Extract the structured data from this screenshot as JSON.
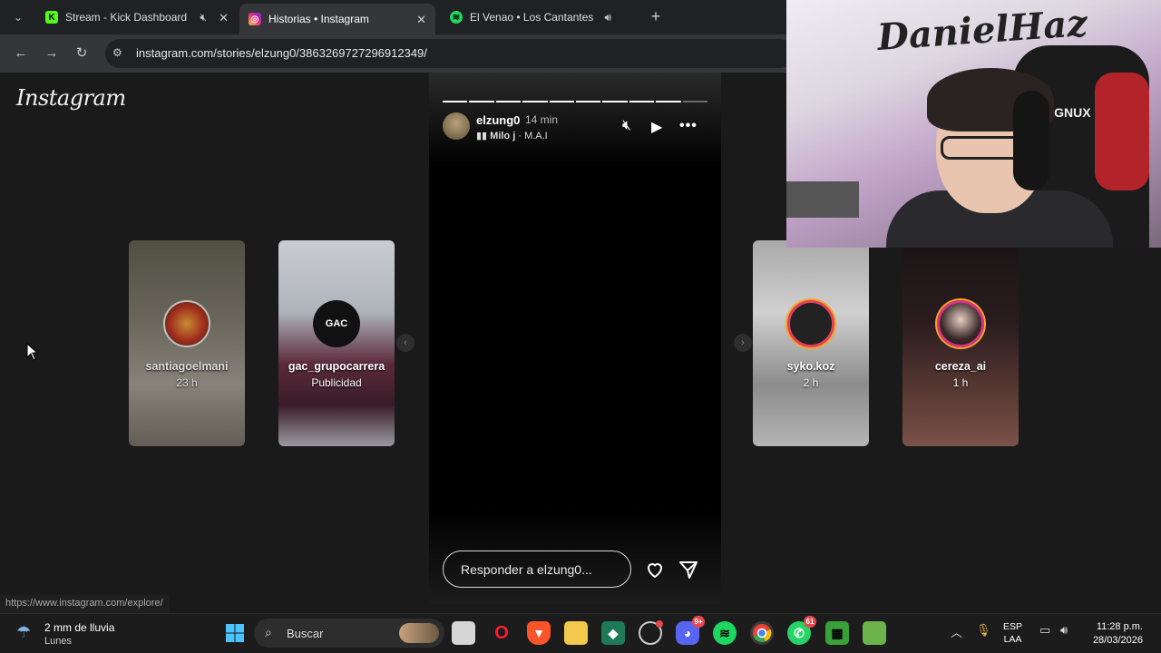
{
  "browser": {
    "tabs": [
      {
        "label": "Stream - Kick Dashboard",
        "icon": "kick-icon",
        "muted": true
      },
      {
        "label": "Historias • Instagram",
        "icon": "instagram-icon",
        "active": true
      },
      {
        "label": "El Venao • Los Cantantes",
        "icon": "spotify-icon",
        "audio": true
      }
    ],
    "url": "instagram.com/stories/elzung0/3863269727296912349/",
    "status_url": "https://www.instagram.com/explore/"
  },
  "instagram": {
    "logo": "Instagram",
    "left_stories": [
      {
        "user": "santiagoelmani",
        "sub": "23 h"
      },
      {
        "user": "gac_grupocarrera",
        "sub": "Publicidad",
        "avatar_text": "GAC"
      }
    ],
    "right_stories": [
      {
        "user": "syko.koz",
        "sub": "2 h"
      },
      {
        "user": "cereza_ai",
        "sub": "1 h"
      }
    ],
    "story": {
      "user": "elzung0",
      "time": "14 min",
      "song": "Milo j",
      "artist": "M.A.I",
      "reply_placeholder": "Responder a elzung0...",
      "progress_done": 9,
      "progress_total": 10
    }
  },
  "webcam": {
    "graffiti": "DanielHaz",
    "chair_text": "AGNUX"
  },
  "taskbar": {
    "weather_line1": "2 mm de lluvia",
    "weather_line2": "Lunes",
    "search_label": "Buscar",
    "discord_badge": "9+",
    "whatsapp_badge": "61",
    "lang1": "ESP",
    "lang2": "LAA",
    "time": "11:28 p.m.",
    "date": "28/03/2026"
  }
}
